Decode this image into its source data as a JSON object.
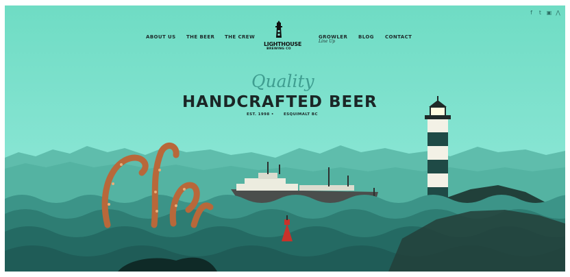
{
  "social": {
    "facebook": "f",
    "twitter": "t",
    "instagram": "▣",
    "untappd": "⋀"
  },
  "nav": {
    "about": "ABOUT US",
    "beer": "THE BEER",
    "crew": "THE CREW",
    "growler": "GROWLER",
    "growler_sub": "Line Up",
    "blog": "BLOG",
    "contact": "CONTACT"
  },
  "logo": {
    "name": "LIGHTHOUSE",
    "sub": "BREWING CO"
  },
  "hero": {
    "script": "Quality",
    "headline": "HANDCRAFTED BEER",
    "established": "EST. 1998 •",
    "location": "ESQUIMALT BC"
  },
  "colors": {
    "sky": "#7fe0cc",
    "mountain": "#5bbaa8",
    "sea_dark": "#1f5c57",
    "sea_mid": "#2e7d73",
    "sea_light": "#3c9488",
    "island": "#23403a",
    "kraken": "#b8683a",
    "text": "#1b2626",
    "script": "#3f9d90"
  }
}
